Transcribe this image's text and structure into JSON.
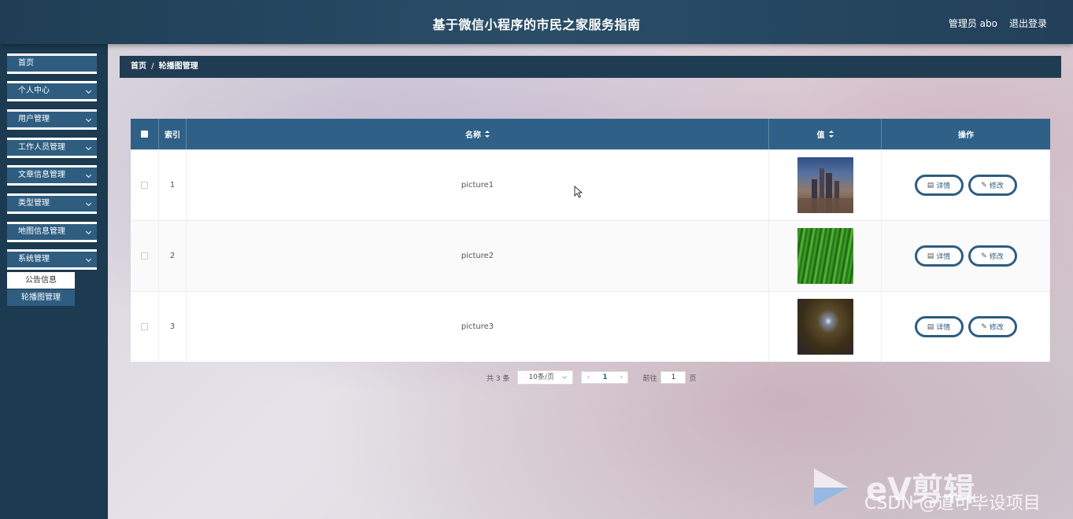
{
  "header": {
    "title": "基于微信小程序的市民之家服务指南",
    "admin": "管理员 abo",
    "logout": "退出登录"
  },
  "sidebar": {
    "items": [
      {
        "label": "首页"
      },
      {
        "label": "个人中心"
      },
      {
        "label": "用户管理"
      },
      {
        "label": "工作人员管理"
      },
      {
        "label": "文章信息管理"
      },
      {
        "label": "类型管理"
      },
      {
        "label": "地图信息管理"
      },
      {
        "label": "系统管理"
      }
    ],
    "subitems": [
      {
        "label": "公告信息"
      },
      {
        "label": "轮播图管理"
      }
    ]
  },
  "breadcrumb": {
    "home": "首页",
    "separator": "/",
    "current": "轮播图管理"
  },
  "table": {
    "headers": {
      "index": "索引",
      "name": "名称",
      "value": "值",
      "actions": "操作"
    },
    "rows": [
      {
        "index": "1",
        "name": "picture1"
      },
      {
        "index": "2",
        "name": "picture2"
      },
      {
        "index": "3",
        "name": "picture3"
      }
    ],
    "detail_label": "详情",
    "edit_label": "修改"
  },
  "pagination": {
    "total": "共 3 条",
    "page_size": "10条/页",
    "current_page": "1",
    "goto_label": "前往",
    "goto_value": "1",
    "page_unit": "页"
  },
  "watermark": {
    "brand": "eV剪辑",
    "credit": "CSDN @道可毕设项目"
  },
  "colors": {
    "header_bg": "#22405a",
    "sidebar_bg": "#1c3a50",
    "accent": "#2e6088"
  }
}
